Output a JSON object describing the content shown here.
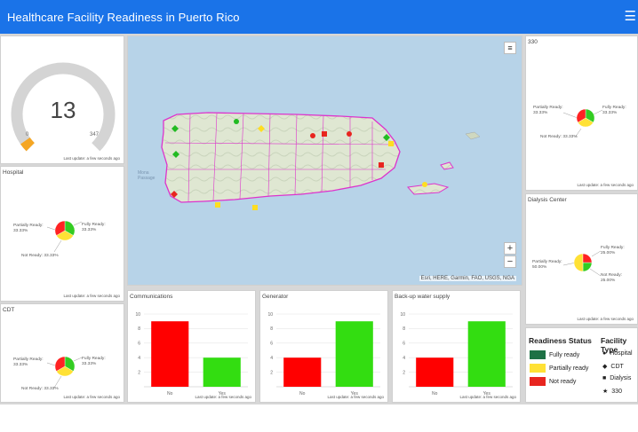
{
  "header": {
    "title": "Healthcare Facility Readiness in Puerto Rico",
    "menu_icon": "hamburger-icon"
  },
  "gauge": {
    "value": "13",
    "min": "0",
    "max": "347",
    "fraction": 0.0375,
    "updated": "Last update: a few seconds ago"
  },
  "hospital": {
    "title": "Hospital",
    "partially": "Partially Ready:\n33.33%",
    "fully": "Fully Ready:\n33.33%",
    "notready": "Not Ready: 33.33%",
    "updated": "Last update: a few seconds ago",
    "slices": [
      33.33,
      33.33,
      33.33
    ]
  },
  "cdt": {
    "title": "CDT",
    "partially": "Partially Ready:\n33.33%",
    "fully": "Fully Ready:\n33.33%",
    "notready": "Not Ready: 33.33%",
    "updated": "Last update: a few seconds ago",
    "slices": [
      33.33,
      33.33,
      33.33
    ]
  },
  "c330": {
    "title": "330",
    "partially": "Partially Ready:\n33.33%",
    "fully": "Fully Ready:\n33.33%",
    "notready": "Not Ready: 33.33%",
    "updated": "Last update: a few seconds ago",
    "slices": [
      33.33,
      33.33,
      33.33
    ]
  },
  "dialysis": {
    "title": "Dialysis Center",
    "partially": "Partially Ready:\n50.00%",
    "fully": "Fully Ready:\n25.00%",
    "notready": "Not Ready: 25.00%",
    "updated": "Last update: a few seconds ago",
    "slices": [
      25.0,
      50.0,
      25.0
    ]
  },
  "map": {
    "attribution": "Esri, HERE, Garmin, FAO, USGS, NGA",
    "zoom_in": "+",
    "zoom_out": "−",
    "sea_label": "Mona\nPassage",
    "layers_icon": "layers-icon"
  },
  "legend": {
    "status_title": "Readiness Status",
    "type_title": "Facility Type",
    "status_items": [
      {
        "label": "Fully ready",
        "color": "#1e7145"
      },
      {
        "label": "Partially ready",
        "color": "#ffe135"
      },
      {
        "label": "Not ready",
        "color": "#e8251f"
      }
    ],
    "type_items": [
      {
        "label": "Hospital",
        "symbol": "●"
      },
      {
        "label": "CDT",
        "symbol": "◆"
      },
      {
        "label": "Dialysis",
        "symbol": "■"
      },
      {
        "label": "330",
        "symbol": "★"
      }
    ]
  },
  "chart_data": [
    {
      "type": "bar",
      "title": "Communications",
      "categories": [
        "No",
        "Yes"
      ],
      "values": [
        9,
        4
      ],
      "colors": [
        "#ff0000",
        "#33dd11"
      ],
      "ylim": [
        0,
        10
      ],
      "yticks": [
        2,
        4,
        6,
        8,
        10
      ],
      "updated": "Last update: a few seconds ago"
    },
    {
      "type": "bar",
      "title": "Generator",
      "categories": [
        "No",
        "Yes"
      ],
      "values": [
        4,
        9
      ],
      "colors": [
        "#ff0000",
        "#33dd11"
      ],
      "ylim": [
        0,
        10
      ],
      "yticks": [
        2,
        4,
        6,
        8,
        10
      ],
      "updated": "Last update: a few seconds ago"
    },
    {
      "type": "bar",
      "title": "Back-up water supply",
      "categories": [
        "No",
        "Yes"
      ],
      "values": [
        4,
        9
      ],
      "colors": [
        "#ff0000",
        "#33dd11"
      ],
      "ylim": [
        0,
        10
      ],
      "yticks": [
        2,
        4,
        6,
        8,
        10
      ],
      "updated": "Last update: a few seconds ago"
    }
  ]
}
